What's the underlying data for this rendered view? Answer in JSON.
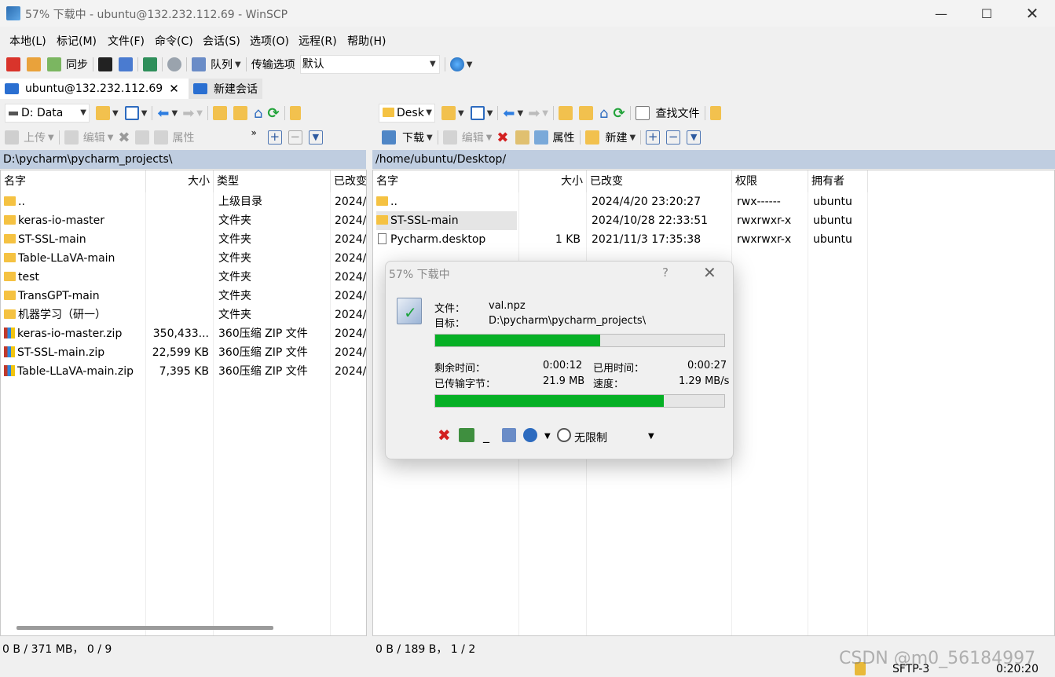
{
  "window": {
    "title": "57% 下载中 - ubuntu@132.232.112.69 - WinSCP"
  },
  "menu": [
    "本地(L)",
    "标记(M)",
    "文件(F)",
    "命令(C)",
    "会话(S)",
    "选项(O)",
    "远程(R)",
    "帮助(H)"
  ],
  "toolbar": {
    "sync_label": "同步",
    "queue_label": "队列",
    "transfer_options_label": "传输选项",
    "transfer_preset": "默认"
  },
  "tabs": {
    "session": "ubuntu@132.232.112.69",
    "new_session": "新建会话"
  },
  "local": {
    "drive": "D: Data",
    "upload_label": "上传",
    "edit_label": "编辑",
    "props_label": "属性",
    "path": "D:\\pycharm\\pycharm_projects\\",
    "columns": [
      "名字",
      "大小",
      "类型",
      "已改变"
    ],
    "rows": [
      {
        "name": "..",
        "size": "",
        "type": "上级目录",
        "changed": "2024/"
      },
      {
        "name": "keras-io-master",
        "size": "",
        "type": "文件夹",
        "changed": "2024/"
      },
      {
        "name": "ST-SSL-main",
        "size": "",
        "type": "文件夹",
        "changed": "2024/"
      },
      {
        "name": "Table-LLaVA-main",
        "size": "",
        "type": "文件夹",
        "changed": "2024/"
      },
      {
        "name": "test",
        "size": "",
        "type": "文件夹",
        "changed": "2024/"
      },
      {
        "name": "TransGPT-main",
        "size": "",
        "type": "文件夹",
        "changed": "2024/"
      },
      {
        "name": "机器学习（研一）",
        "size": "",
        "type": "文件夹",
        "changed": "2024/"
      },
      {
        "name": "keras-io-master.zip",
        "size": "350,433...",
        "type": "360压缩 ZIP 文件",
        "changed": "2024/"
      },
      {
        "name": "ST-SSL-main.zip",
        "size": "22,599 KB",
        "type": "360压缩 ZIP 文件",
        "changed": "2024/"
      },
      {
        "name": "Table-LLaVA-main.zip",
        "size": "7,395 KB",
        "type": "360压缩 ZIP 文件",
        "changed": "2024/"
      }
    ],
    "status": "0 B / 371 MB，  0 / 9"
  },
  "remote": {
    "dir_label": "Desk",
    "download_label": "下载",
    "edit_label": "编辑",
    "props_label": "属性",
    "new_label": "新建",
    "find_label": "查找文件",
    "path": "/home/ubuntu/Desktop/",
    "columns": [
      "名字",
      "大小",
      "已改变",
      "权限",
      "拥有者"
    ],
    "rows": [
      {
        "name": "..",
        "size": "",
        "changed": "2024/4/20 23:20:27",
        "rights": "rwx------",
        "owner": "ubuntu"
      },
      {
        "name": "ST-SSL-main",
        "size": "",
        "changed": "2024/10/28 22:33:51",
        "rights": "rwxrwxr-x",
        "owner": "ubuntu"
      },
      {
        "name": "Pycharm.desktop",
        "size": "1 KB",
        "changed": "2021/11/3 17:35:38",
        "rights": "rwxrwxr-x",
        "owner": "ubuntu"
      }
    ],
    "status": "0 B / 189 B，  1 / 2"
  },
  "dialog": {
    "title": "57% 下载中",
    "help": "?",
    "file_label": "文件：",
    "file_value": "val.npz",
    "target_label": "目标：",
    "target_value": "D:\\pycharm\\pycharm_projects\\",
    "file_progress": 0.57,
    "remaining_label": "剩余时间：",
    "remaining_value": "0:00:12",
    "elapsed_label": "已用时间：",
    "elapsed_value": "0:00:27",
    "transferred_label": "已传输字节：",
    "transferred_value": "21.9 MB",
    "speed_label": "速度：",
    "speed_value": "1.29 MB/s",
    "total_progress": 0.79,
    "speed_limit": "无限制"
  },
  "statusbar": {
    "protocol": "SFTP-3",
    "time": "0:20:20"
  },
  "watermark": "CSDN @m0_56184997",
  "colors": {
    "progress": "#06b025",
    "pathbar": "#bfcde0",
    "selection": "#e5e5e5"
  }
}
